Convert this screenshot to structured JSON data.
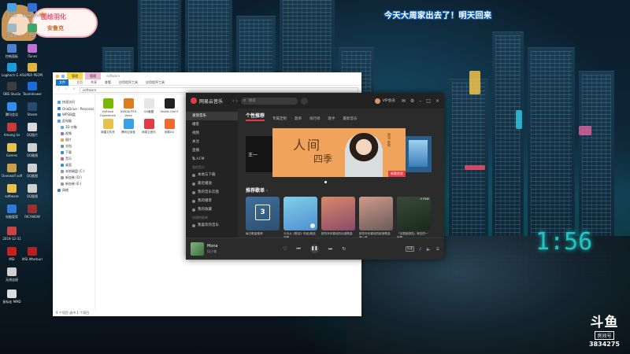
{
  "badge": {
    "line1": "图绘羽化",
    "line2": "安鲁克"
  },
  "banner": {
    "text": "今天大周家出去了！明天回来"
  },
  "watermark": {
    "logo": "斗鱼",
    "room_label": "房间号",
    "room_number": "3834275"
  },
  "desktop_icons": [
    {
      "label": "此电脑",
      "color": "#4aa3df"
    },
    {
      "label": "Ubisoft Connect",
      "color": "#2f6fd6"
    },
    {
      "label": "回收站",
      "color": "#9fb8c8"
    },
    {
      "label": "TTP",
      "color": "#3fa56a"
    },
    {
      "label": "控制面板",
      "color": "#4c7fd0"
    },
    {
      "label": "iTunes",
      "color": "#c26fd6"
    },
    {
      "label": "Logitech G HUB",
      "color": "#1c9cd8"
    },
    {
      "label": "SUPER PEOPLE CBT",
      "color": "#e0b340"
    },
    {
      "label": "OBS Studio",
      "color": "#3c3c3c"
    },
    {
      "label": "TeamViewer",
      "color": "#1d6bd8"
    },
    {
      "label": "腾讯会议",
      "color": "#2f8ef0"
    },
    {
      "label": "Steam",
      "color": "#294a6b"
    },
    {
      "label": "Among Us",
      "color": "#c83a3a"
    },
    {
      "label": "QQ图片",
      "color": "#d9d9d9"
    },
    {
      "label": "Games",
      "color": "#e8c04c"
    },
    {
      "label": "QQ截图",
      "color": "#cfcfcf"
    },
    {
      "label": "Overwolf software",
      "color": "#c8a14a"
    },
    {
      "label": "QQ截图",
      "color": "#cfcfcf"
    },
    {
      "label": "software",
      "color": "#e8c04c"
    },
    {
      "label": "QQ截图",
      "color": "#cfcfcf"
    },
    {
      "label": "电脑管家",
      "color": "#2e7ad8"
    },
    {
      "label": "RICANOW",
      "color": "#9a2f2f"
    },
    {
      "label": "2019-12-31",
      "color": "#c84444"
    },
    {
      "label": "MSI",
      "color": "#c82020"
    },
    {
      "label": "MSI Afterburner",
      "color": "#b51f1f"
    },
    {
      "label": "无线连接",
      "color": "#cfcfcf"
    },
    {
      "label": "鼠标宏 MMD",
      "color": "#dcdcdc"
    }
  ],
  "explorer": {
    "quick_tab_1": "管理",
    "quick_tab_2": "管理",
    "path_title": "software",
    "ribbon": [
      "文件",
      "主页",
      "共享",
      "查看",
      "应用程序工具",
      "应用程序工具"
    ],
    "address": "software",
    "status": "9 个项目   选中 1 个项目",
    "nav": [
      {
        "label": "快速访问",
        "color": "#4aa3df",
        "sub": false,
        "selected": false
      },
      {
        "label": "OneDrive - Personal",
        "color": "#2f7fd6",
        "sub": false,
        "selected": false
      },
      {
        "label": "WPS网盘",
        "color": "#2f7fd6",
        "sub": false,
        "selected": false
      },
      {
        "label": "此电脑",
        "color": "#4aa3df",
        "sub": false,
        "selected": false
      },
      {
        "label": "3D 对象",
        "color": "#62a8e0",
        "sub": true,
        "selected": false
      },
      {
        "label": "视频",
        "color": "#8a6fd0",
        "sub": true,
        "selected": false
      },
      {
        "label": "图片",
        "color": "#e0a84a",
        "sub": true,
        "selected": false
      },
      {
        "label": "文档",
        "color": "#6f8fb0",
        "sub": true,
        "selected": false
      },
      {
        "label": "下载",
        "color": "#3a8ad6",
        "sub": true,
        "selected": false
      },
      {
        "label": "音乐",
        "color": "#d06080",
        "sub": true,
        "selected": false
      },
      {
        "label": "桌面",
        "color": "#3a8ad6",
        "sub": true,
        "selected": false
      },
      {
        "label": "本地磁盘 (C:)",
        "color": "#8a9aab",
        "sub": true,
        "selected": false
      },
      {
        "label": "新加卷 (D:)",
        "color": "#8a9aab",
        "sub": true,
        "selected": false
      },
      {
        "label": "新加卷 (E:)",
        "color": "#8a9aab",
        "sub": true,
        "selected": false
      },
      {
        "label": "网络",
        "color": "#4a7fb0",
        "sub": false,
        "selected": false
      }
    ],
    "files": [
      {
        "label": "GeForce Experience",
        "color": "#76b900"
      },
      {
        "label": "NVIDIA RTX Voice",
        "color": "#e07a1c"
      },
      {
        "label": "QQ截图",
        "color": "#e6e6e6"
      },
      {
        "label": "Studio One 5",
        "color": "#222222"
      },
      {
        "label": "新建文件夹",
        "color": "#e8c04c"
      },
      {
        "label": "腾讯应用宝",
        "color": "#39a0e8"
      },
      {
        "label": "网易云音乐",
        "color": "#e63946"
      },
      {
        "label": "网易UU",
        "color": "#f06a30"
      }
    ]
  },
  "music": {
    "app_name": "网易云音乐",
    "search_placeholder": "搜索",
    "user_name": "VIP会员",
    "sidebar": [
      {
        "type": "item",
        "label": "发现音乐",
        "active": true
      },
      {
        "type": "item",
        "label": "播客",
        "active": false
      },
      {
        "type": "item",
        "label": "视频",
        "active": false
      },
      {
        "type": "item",
        "label": "关注",
        "active": false
      },
      {
        "type": "item",
        "label": "直播",
        "active": false
      },
      {
        "type": "item",
        "label": "私人FM",
        "active": false
      },
      {
        "type": "header",
        "label": "我的音乐"
      },
      {
        "type": "item",
        "label": "本地与下载",
        "active": false
      },
      {
        "type": "item",
        "label": "最近播放",
        "active": false
      },
      {
        "type": "item",
        "label": "我的音乐云盘",
        "active": false
      },
      {
        "type": "item",
        "label": "我的播客",
        "active": false
      },
      {
        "type": "item",
        "label": "我的收藏",
        "active": false
      },
      {
        "type": "header",
        "label": "创建的歌单"
      },
      {
        "type": "item",
        "label": "我喜欢的音乐",
        "active": false
      }
    ],
    "tabs": [
      "个性推荐",
      "专属定制",
      "歌单",
      "排行榜",
      "歌手",
      "最新音乐"
    ],
    "carousel": {
      "left_text": "王一",
      "calligraphy_1": "人间",
      "calligraphy_2": "四季",
      "vertical_text": "周深 新歌",
      "tag": "新歌首发"
    },
    "section_title": "推荐歌单",
    "cards": [
      {
        "caption": "每日歌曲推荐",
        "color1": "#3f6f9a",
        "color2": "#2c4f72",
        "count": "",
        "calendar_day": "3"
      },
      {
        "caption": "今天从《歌名》听起|精选好歌",
        "color1": "#7fd0e8",
        "color2": "#4f8fd0",
        "count": "",
        "calendar_day": ""
      },
      {
        "caption": "那些年你喜欢的动漫歌曲",
        "color1": "#d88a6a",
        "color2": "#8a4a6a",
        "count": "",
        "calendar_day": ""
      },
      {
        "caption": "那些年你喜欢的欧美歌曲第一首",
        "color1": "#d09a8a",
        "color2": "#6a5a5a",
        "count": "",
        "calendar_day": ""
      },
      {
        "caption": "「无限制感觉」常在的一首歌",
        "color1": "#3a4a3a",
        "color2": "#1a2a1a",
        "count": "↺ FINE",
        "calendar_day": ""
      }
    ],
    "player": {
      "song": "Mona",
      "artist": "Dj小鲁",
      "quality": "标准"
    }
  }
}
